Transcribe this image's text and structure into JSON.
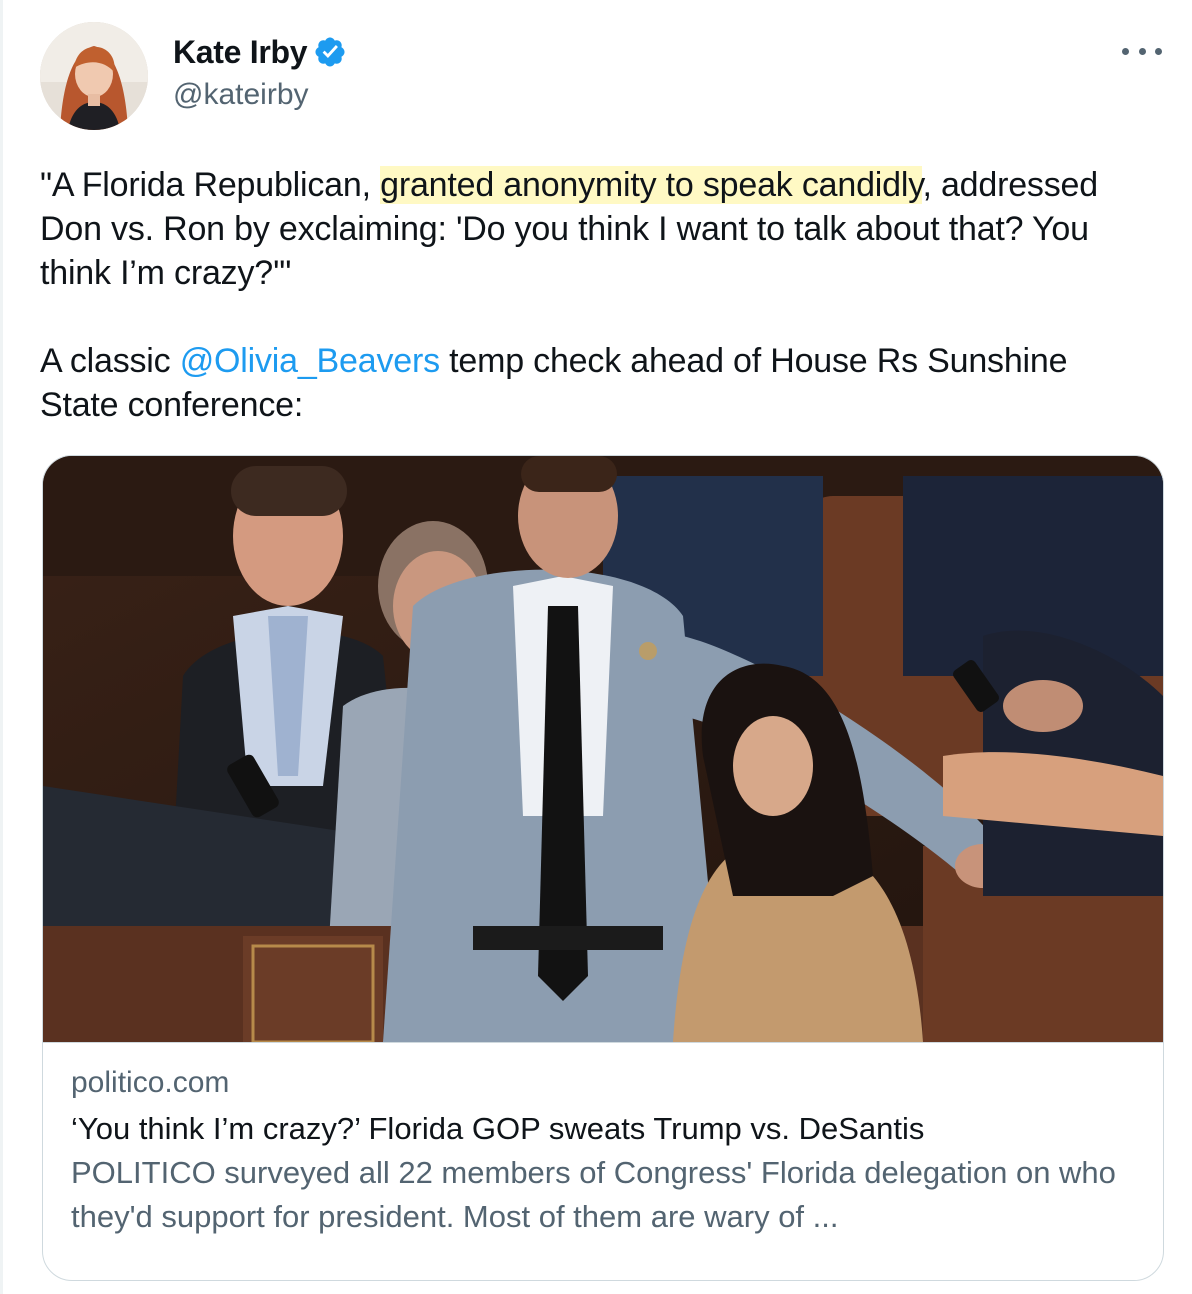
{
  "author": {
    "name": "Kate Irby",
    "handle": "@kateirby",
    "verified_color": "#1d9bf0"
  },
  "tweet": {
    "p1_part1": "\"A Florida Republican, ",
    "p1_highlight": "granted anonymity to speak candidly",
    "p1_part2": ", addressed Don vs. Ron by exclaiming: 'Do you think I want to talk about that? You think I’m crazy?'\"",
    "p2_part1": "A classic ",
    "p2_mention": "@Olivia_Beavers",
    "p2_part2": " temp check ahead of House Rs Sunshine State conference:",
    "highlight_color": "#fff9c4",
    "link_color": "#1d9bf0"
  },
  "card": {
    "domain": "politico.com",
    "title": "‘You think I’m crazy?’ Florida GOP sweats Trump vs. DeSantis",
    "description": "POLITICO surveyed all 22 members of Congress' Florida delegation on who they'd support for president. Most of them are wary of ..."
  }
}
